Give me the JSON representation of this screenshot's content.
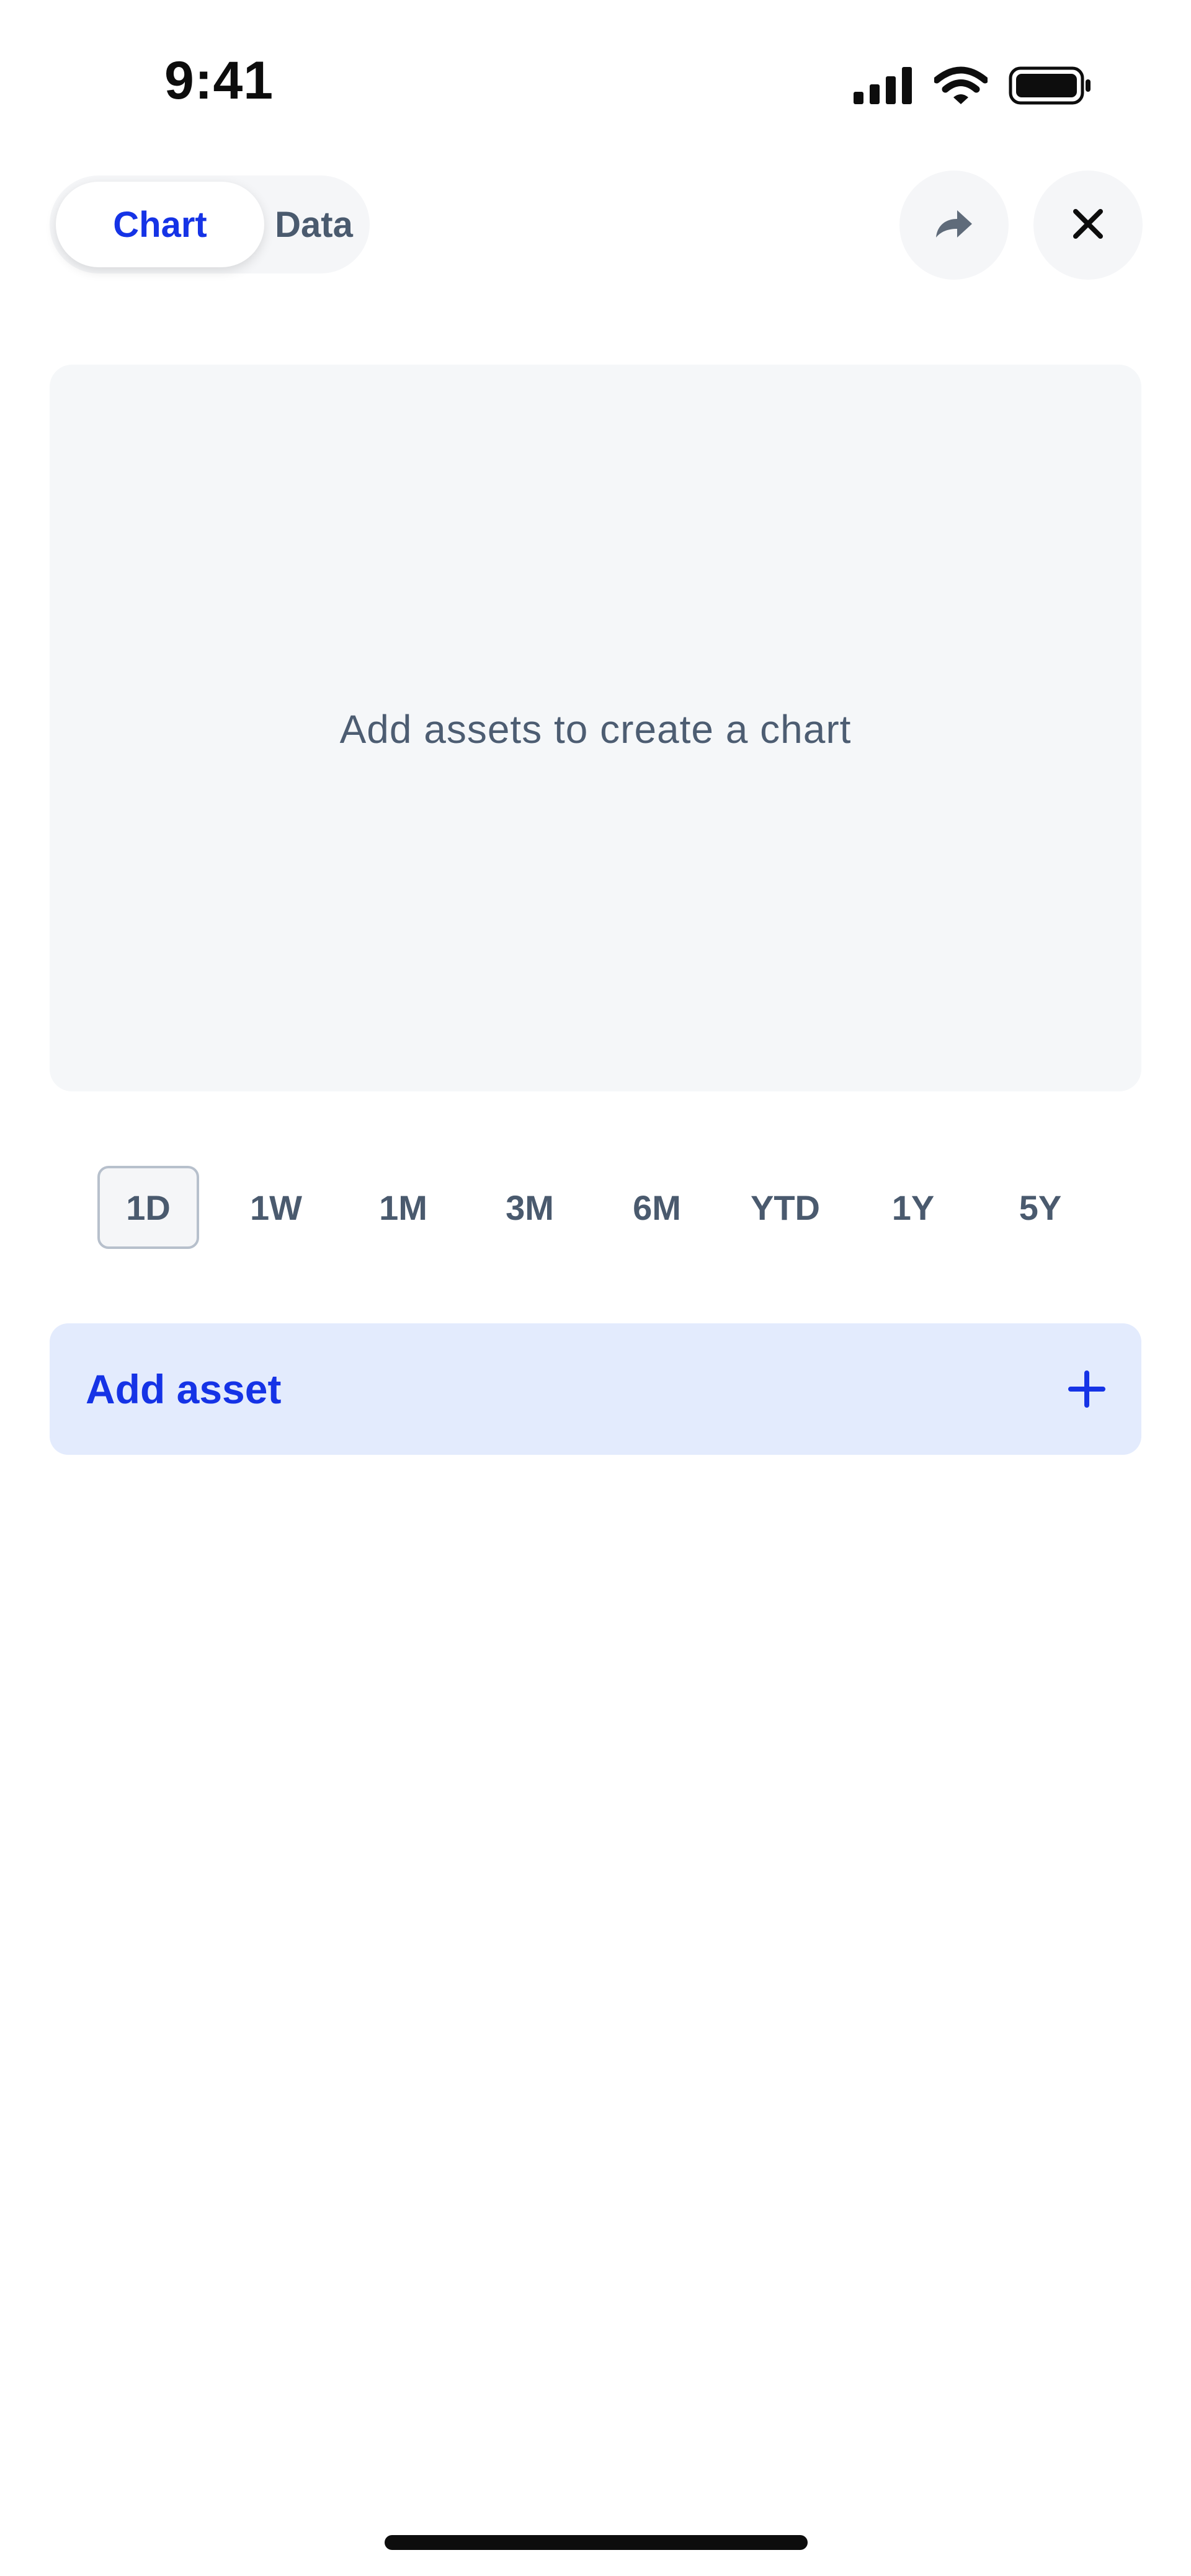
{
  "status_bar": {
    "time": "9:41",
    "icons": [
      "cellular-signal-icon",
      "wifi-icon",
      "battery-icon"
    ]
  },
  "view_toggle": {
    "options": [
      {
        "label": "Chart",
        "selected": true
      },
      {
        "label": "Data",
        "selected": false
      }
    ]
  },
  "actions": {
    "share_icon": "share-arrow-icon",
    "close_icon": "close-icon"
  },
  "chart": {
    "empty_message": "Add assets to create a chart"
  },
  "ranges": {
    "items": [
      "1D",
      "1W",
      "1M",
      "3M",
      "6M",
      "YTD",
      "1Y",
      "5Y"
    ],
    "selected": "1D"
  },
  "add_asset": {
    "label": "Add asset",
    "icon": "plus-icon"
  },
  "colors": {
    "accent": "#1533e6",
    "muted_text": "#4a5a6e",
    "panel_bg": "#f5f7f9",
    "add_bg": "#e3ebfd"
  }
}
